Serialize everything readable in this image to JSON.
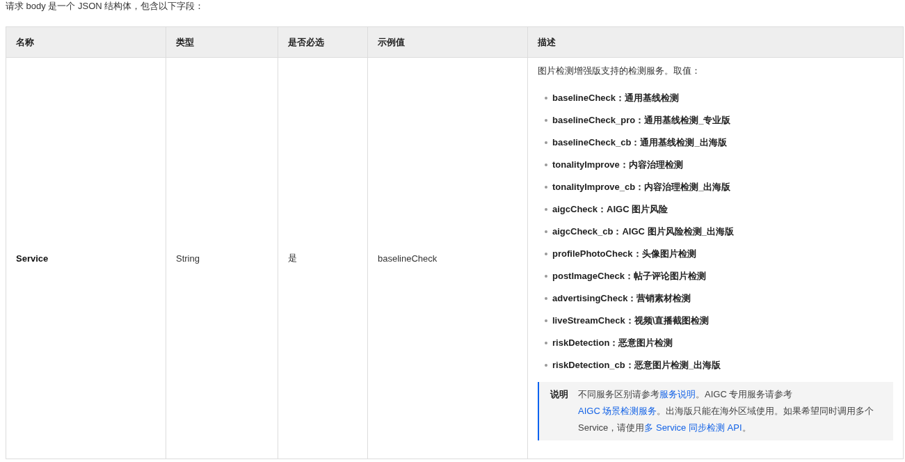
{
  "intro": "请求 body 是一个 JSON 结构体，包含以下字段：",
  "table": {
    "columns": [
      "名称",
      "类型",
      "是否必选",
      "示例值",
      "描述"
    ],
    "rows": [
      {
        "name": "Service",
        "type": "String",
        "required": "是",
        "example": "baselineCheck",
        "description": {
          "text": "图片检测增强版支持的检测服务。取值：",
          "options": [
            "baselineCheck：通用基线检测",
            "baselineCheck_pro：通用基线检测_专业版",
            "baselineCheck_cb：通用基线检测_出海版",
            "tonalityImprove：内容治理检测",
            "tonalityImprove_cb：内容治理检测_出海版",
            "aigcCheck：AIGC 图片风险",
            "aigcCheck_cb：AIGC 图片风险检测_出海版",
            "profilePhotoCheck：头像图片检测",
            "postImageCheck：帖子评论图片检测",
            "advertisingCheck：营销素材检测",
            "liveStreamCheck：视频\\直播截图检测",
            "riskDetection：恶意图片检测",
            "riskDetection_cb：恶意图片检测_出海版"
          ],
          "note": {
            "label": "说明",
            "segments": [
              {
                "kind": "text",
                "text": "不同服务区别请参考"
              },
              {
                "kind": "link",
                "text": "服务说明"
              },
              {
                "kind": "text",
                "text": "。AIGC 专用服务请参考 "
              },
              {
                "kind": "link",
                "text": "AIGC 场景检测服务"
              },
              {
                "kind": "text",
                "text": "。出海版只能在海外区域使用。如果希望同时调用多个 Service，请使用"
              },
              {
                "kind": "link",
                "text": "多 Service 同步检测 API"
              },
              {
                "kind": "text",
                "text": "。"
              }
            ]
          }
        }
      }
    ]
  }
}
